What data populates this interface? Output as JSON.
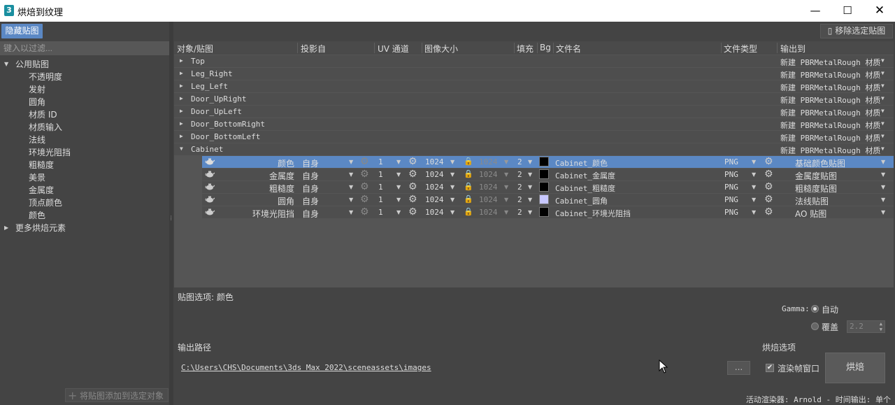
{
  "window": {
    "title": "烘焙到纹理",
    "icon_text": "3",
    "minimize": "—",
    "maximize": "☐",
    "close": "✕"
  },
  "left": {
    "hide_button": "隐藏贴图",
    "filter_placeholder": "键入以过滤...",
    "tree": [
      {
        "label": "公用贴图",
        "expanded": true
      },
      {
        "label": "不透明度"
      },
      {
        "label": "发射"
      },
      {
        "label": "圆角"
      },
      {
        "label": "材质 ID"
      },
      {
        "label": "材质输入"
      },
      {
        "label": "法线"
      },
      {
        "label": "环境光阻挡"
      },
      {
        "label": "粗糙度"
      },
      {
        "label": "美景"
      },
      {
        "label": "金属度"
      },
      {
        "label": "顶点颜色"
      },
      {
        "label": "颜色"
      },
      {
        "label": "更多烘焙元素",
        "expanded": false
      }
    ],
    "add_button": "将贴图添加到选定对象"
  },
  "toolbar": {
    "remove_button": "移除选定贴图"
  },
  "grid": {
    "headers": [
      "对象/贴图",
      "投影自",
      "UV 通道",
      "图像大小",
      "填充",
      "Bg",
      "文件名",
      "文件类型",
      "输出到"
    ],
    "objects": [
      {
        "name": "Top",
        "output": "新建 PBRMetalRough 材质"
      },
      {
        "name": "Leg_Right",
        "output": "新建 PBRMetalRough 材质"
      },
      {
        "name": "Leg_Left",
        "output": "新建 PBRMetalRough 材质"
      },
      {
        "name": "Door_UpRight",
        "output": "新建 PBRMetalRough 材质"
      },
      {
        "name": "Door_UpLeft",
        "output": "新建 PBRMetalRough 材质"
      },
      {
        "name": "Door_BottomRight",
        "output": "新建 PBRMetalRough 材质"
      },
      {
        "name": "Door_BottomLeft",
        "output": "新建 PBRMetalRough 材质"
      },
      {
        "name": "Cabinet",
        "output": "新建 PBRMetalRough 材质",
        "expanded": true
      }
    ],
    "maps": [
      {
        "name": "颜色",
        "proj": "自身",
        "uv": "1",
        "w": "1024",
        "h": "1024",
        "pad": "2",
        "bg": "#000000",
        "file": "Cabinet_颜色",
        "type": "PNG",
        "out": "基础颜色贴图",
        "selected": true
      },
      {
        "name": "金属度",
        "proj": "自身",
        "uv": "1",
        "w": "1024",
        "h": "1024",
        "pad": "2",
        "bg": "#000000",
        "file": "Cabinet_金属度",
        "type": "PNG",
        "out": "金属度贴图"
      },
      {
        "name": "粗糙度",
        "proj": "自身",
        "uv": "1",
        "w": "1024",
        "h": "1024",
        "pad": "2",
        "bg": "#000000",
        "file": "Cabinet_粗糙度",
        "type": "PNG",
        "out": "粗糙度贴图"
      },
      {
        "name": "圆角",
        "proj": "自身",
        "uv": "1",
        "w": "1024",
        "h": "1024",
        "pad": "2",
        "bg": "#c8c8ff",
        "file": "Cabinet_圆角",
        "type": "PNG",
        "out": "法线贴图"
      },
      {
        "name": "环境光阻挡",
        "proj": "自身",
        "uv": "1",
        "w": "1024",
        "h": "1024",
        "pad": "2",
        "bg": "#000000",
        "file": "Cabinet_环境光阻挡",
        "type": "PNG",
        "out": "AO 贴图"
      }
    ]
  },
  "options": {
    "label": "贴图选项: 颜色",
    "gamma_label": "Gamma:",
    "auto_label": "自动",
    "override_label": "覆盖",
    "gamma_value": "2.2"
  },
  "output": {
    "label": "输出路径",
    "path": "C:\\Users\\CHS\\Documents\\3ds Max 2022\\sceneassets\\images",
    "browse": "..."
  },
  "bake": {
    "label": "烘焙选项",
    "frame_label": "渲染帧窗口",
    "button": "烘焙"
  },
  "status": "活动渲染器: Arnold - 时间输出: 单个",
  "colors": {
    "accent": "#5b88c4",
    "panel": "#444444",
    "grid": "#555555"
  }
}
